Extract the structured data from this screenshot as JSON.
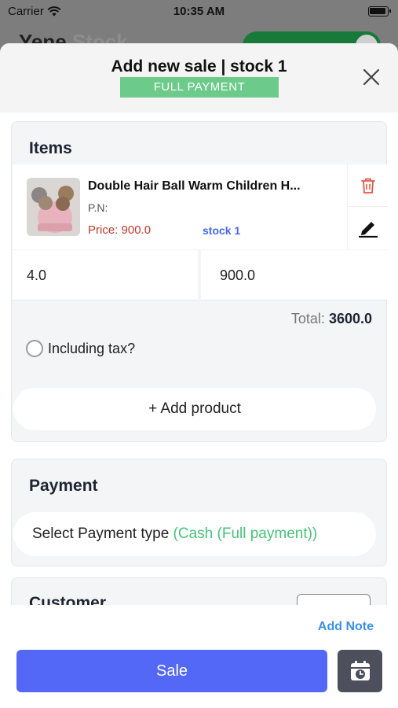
{
  "status_bar": {
    "carrier": "Carrier",
    "time": "10:35 AM"
  },
  "background_app": {
    "title_main": "Yene",
    "title_sub": "Stock"
  },
  "sheet": {
    "title": "Add new sale | stock 1",
    "badge": "FULL PAYMENT",
    "badge_color": "#6ccb8b"
  },
  "items_section": {
    "heading": "Items",
    "items": [
      {
        "name": "Double Hair Ball Warm Children H...",
        "pn_label": "P.N:",
        "price_label": "Price: 900.0",
        "stock_label": "stock 1",
        "quantity": "4.0",
        "unit_price": "900.0"
      }
    ],
    "total_label": "Total:",
    "total_value": "3600.0",
    "tax_label": "Including tax?",
    "add_product_label": "+ Add product"
  },
  "payment_section": {
    "heading": "Payment",
    "type_prefix": "Select Payment type",
    "type_value": "(Cash (Full payment))",
    "highlight_color": "#47c27a"
  },
  "customer_section": {
    "heading": "Customer"
  },
  "footer": {
    "add_note_label": "Add Note",
    "sale_label": "Sale",
    "primary_color": "#5468f8"
  },
  "icons": [
    "wifi-icon",
    "battery-icon",
    "close-icon",
    "trash-icon",
    "edit-icon",
    "calendar-clock-icon",
    "radio-icon"
  ]
}
